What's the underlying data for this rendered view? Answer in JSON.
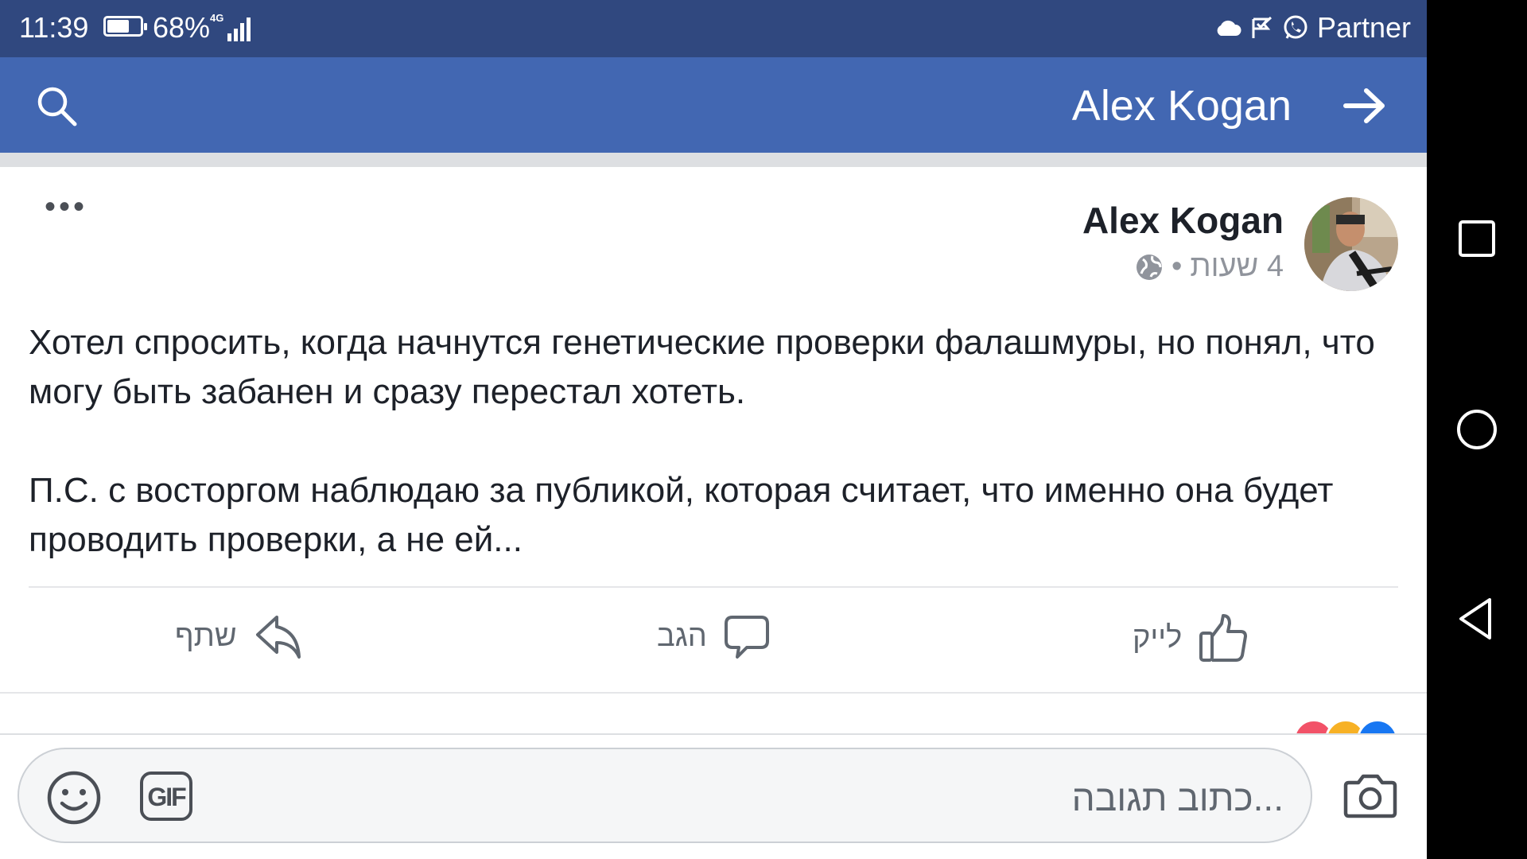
{
  "status_bar": {
    "time": "11:39",
    "battery_percent": "68%",
    "battery_level": 0.68,
    "network": "4G",
    "carrier": "Partner",
    "icons": [
      "cloud-icon",
      "check-flag-icon",
      "whatsapp-icon"
    ]
  },
  "header": {
    "title": "Alex Kogan",
    "search_icon": "search-icon",
    "back_icon": "arrow-right-icon",
    "background": "#4267b2"
  },
  "post": {
    "author": "Alex Kogan",
    "time_ago": "4 שעות",
    "privacy_icon": "globe-icon",
    "paragraphs": [
      "Хотел спросить, когда начнутся генетические проверки фалашмуры, но понял, что могу быть забанен и сразу перестал хотеть.",
      "П.С. с восторгом наблюдаю за публикой, которая считает, что именно она будет проводить проверки, а не ей..."
    ],
    "actions": {
      "like": "לייק",
      "comment": "הגב",
      "share": "שתף"
    }
  },
  "composer": {
    "placeholder": "...כתוב תגובה",
    "gif_label": "GIF"
  },
  "colors": {
    "status_bar": "#30487f",
    "header": "#4267b2",
    "text": "#1d2129",
    "secondary_text": "#606770"
  }
}
